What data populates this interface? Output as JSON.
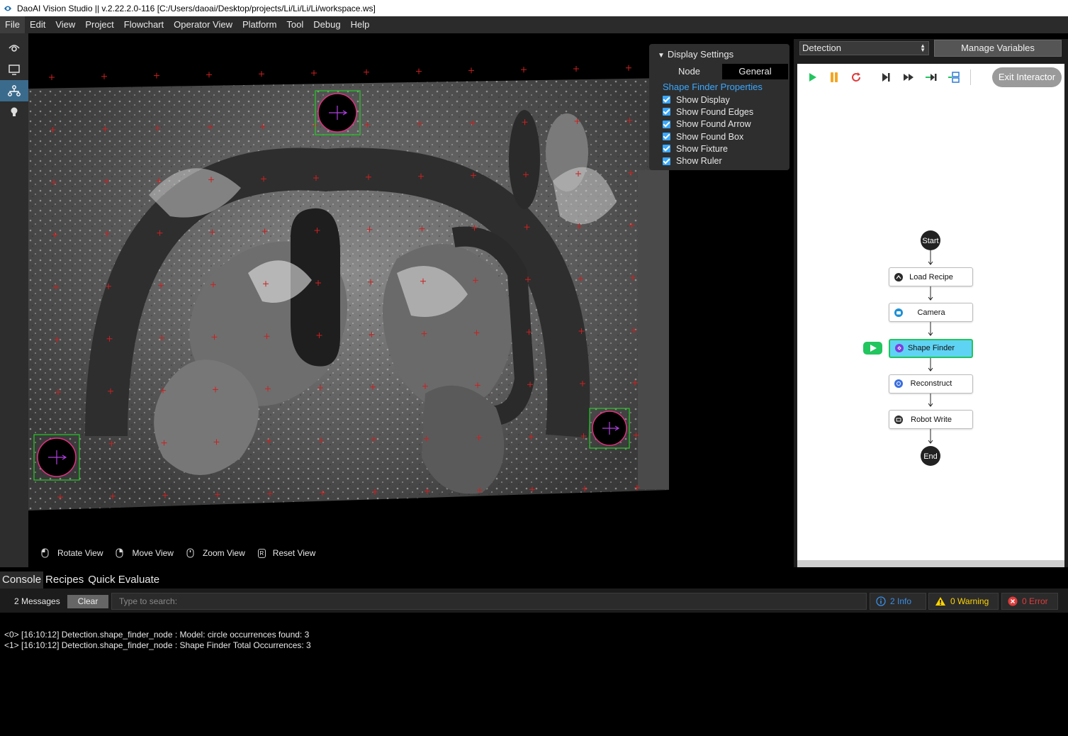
{
  "window": {
    "title": "DaoAI Vision Studio || v.2.22.2.0-116   [C:/Users/daoai/Desktop/projects/Li/Li/Li/Li/workspace.ws]"
  },
  "menu": [
    "File",
    "Edit",
    "View",
    "Project",
    "Flowchart",
    "Operator View",
    "Platform",
    "Tool",
    "Debug",
    "Help"
  ],
  "sidebar_icons": [
    "operator-view-icon",
    "display-icon",
    "flowchart-icon",
    "lightbulb-icon"
  ],
  "display_settings": {
    "header": "Display Settings",
    "tabs": [
      "Node",
      "General"
    ],
    "active_tab": "General",
    "subheader": "Shape Finder Properties",
    "options": [
      {
        "label": "Show Display",
        "checked": true
      },
      {
        "label": "Show Found Edges",
        "checked": true
      },
      {
        "label": "Show Found Arrow",
        "checked": true
      },
      {
        "label": "Show Found Box",
        "checked": true
      },
      {
        "label": "Show Fixture",
        "checked": true
      },
      {
        "label": "Show Ruler",
        "checked": true
      }
    ]
  },
  "view_tools": [
    {
      "key": "mouse-left-icon",
      "label": "Rotate View"
    },
    {
      "key": "mouse-right-icon",
      "label": "Move View"
    },
    {
      "key": "mouse-wheel-icon",
      "label": "Zoom View"
    },
    {
      "key": "R",
      "label": "Reset View"
    }
  ],
  "flow_panel": {
    "selected_flow": "Detection",
    "manage_variables": "Manage Variables",
    "exit_interactor": "Exit Interactor",
    "start_label": "Start",
    "end_label": "End",
    "nodes": [
      {
        "label": "Load Recipe",
        "active": false
      },
      {
        "label": "Camera",
        "active": false
      },
      {
        "label": "Shape Finder",
        "active": true
      },
      {
        "label": "Reconstruct",
        "active": false
      },
      {
        "label": "Robot Write",
        "active": false
      }
    ],
    "colors": {
      "play": "#22c55e",
      "pause": "#f5a623",
      "restart": "#e03c3c",
      "active_node": "#5fd3f3",
      "active_border": "#22c55e"
    }
  },
  "bottom_tabs": [
    "Console",
    "Recipes",
    "Quick Evaluate"
  ],
  "console": {
    "message_count": "2 Messages",
    "clear": "Clear",
    "search_placeholder": "Type to search:",
    "info": "2 Info",
    "warning": "0 Warning",
    "error": "0 Error",
    "lines": [
      "<0> [16:10:12] Detection.shape_finder_node : Model: circle occurrences found: 3",
      "<1> [16:10:12] Detection.shape_finder_node : Shape Finder Total Occurrences: 3"
    ]
  }
}
